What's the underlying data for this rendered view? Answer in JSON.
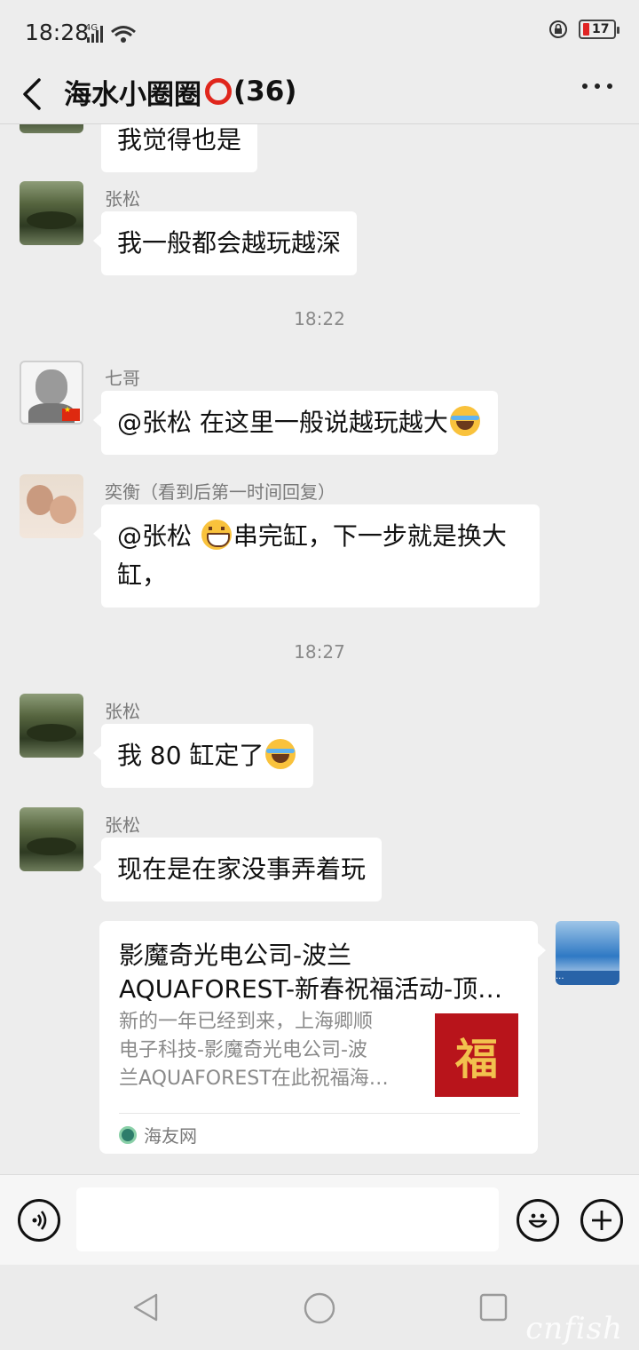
{
  "status": {
    "time": "18:28",
    "network": "4G",
    "battery": "17"
  },
  "header": {
    "title": "海水小圈圈",
    "count": "(36)"
  },
  "messages": [
    {
      "sender": "",
      "text": "我觉得也是"
    },
    {
      "sender": "张松",
      "text": "我一般都会越玩越深"
    },
    {
      "time": "18:22"
    },
    {
      "sender": "七哥",
      "text": "@张松  在这里一般说越玩越大"
    },
    {
      "sender": "奕衡（看到后第一时间回复）",
      "text_a": "@张松 ",
      "text_b": "串完缸，下一步就是换大",
      "text_c": "缸，"
    },
    {
      "time": "18:27"
    },
    {
      "sender": "张松",
      "text": "我 80 缸定了"
    },
    {
      "sender": "张松",
      "text": "现在是在家没事弄着玩"
    }
  ],
  "link_card": {
    "title_line1": "影魔奇光电公司-波兰",
    "title_line2": "AQUAFOREST-新春祝福活动-顶…",
    "desc_line1": "新的一年已经到来，上海卿顺",
    "desc_line2": "电子科技-影魔奇光电公司-波",
    "desc_line3": "兰AQUAFOREST在此祝福海…",
    "thumb_char": "福",
    "source": "海友网"
  },
  "icons": {
    "emoji_types": [
      "cry",
      "grin"
    ]
  },
  "watermark": "cnfish"
}
